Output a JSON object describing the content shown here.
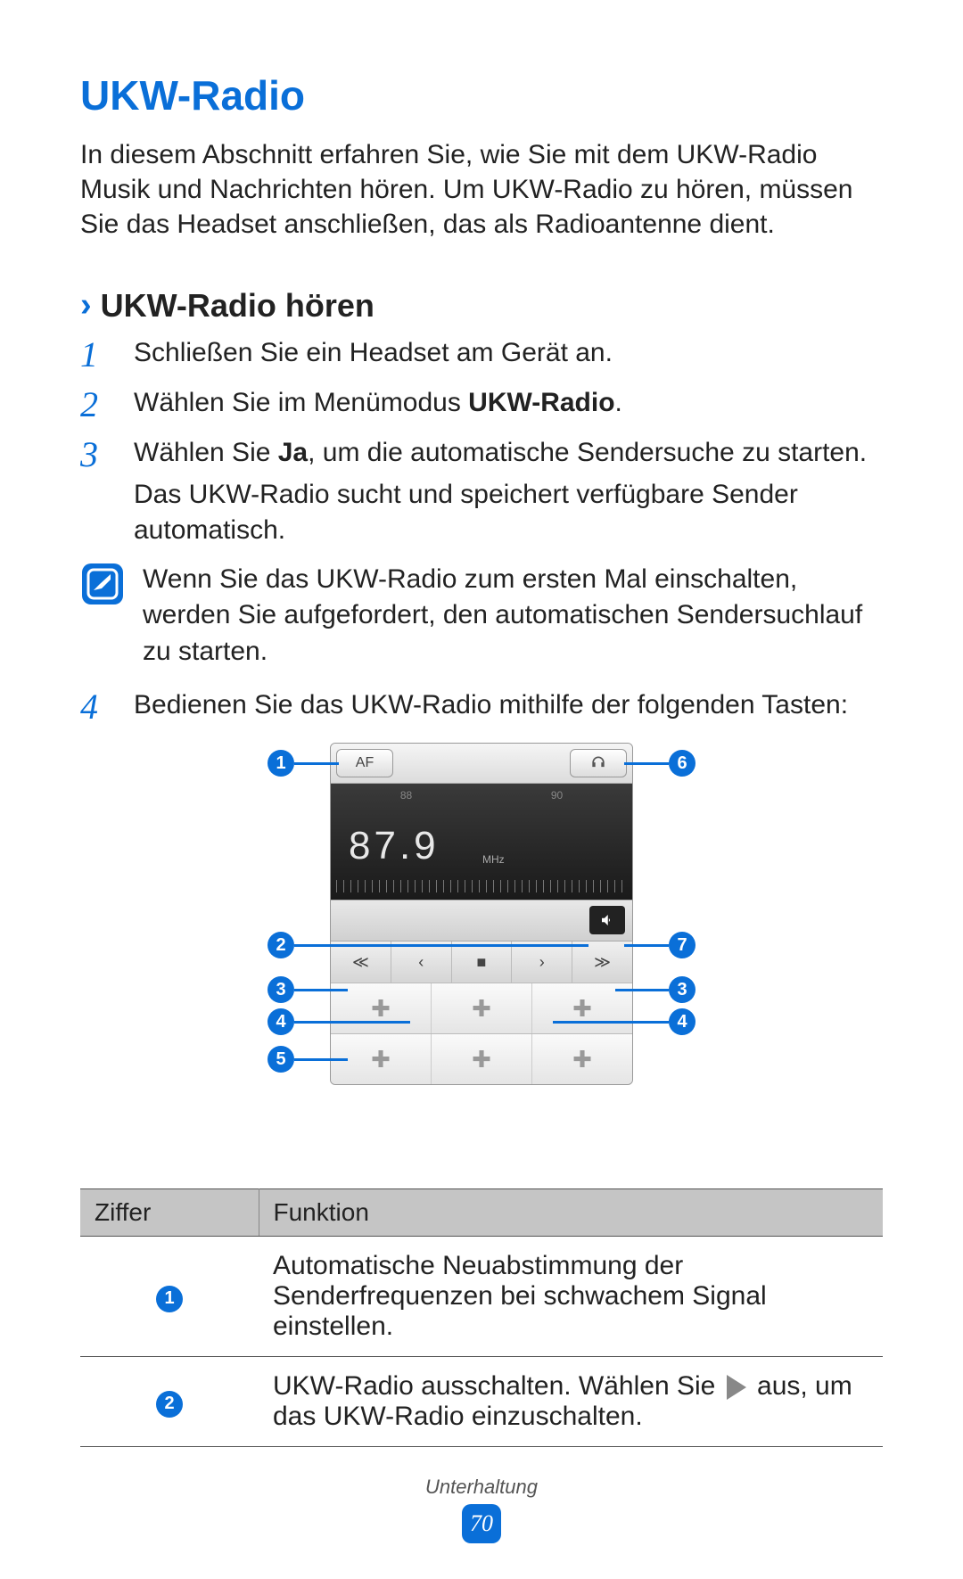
{
  "title": "UKW-Radio",
  "intro": "In diesem Abschnitt erfahren Sie, wie Sie mit dem UKW-Radio Musik und Nachrichten hören. Um UKW-Radio zu hören, müssen Sie das Headset anschließen, das als Radioantenne dient.",
  "section": {
    "chevron": "›",
    "heading": "UKW-Radio hören"
  },
  "steps": {
    "s1": {
      "num": "1",
      "text": "Schließen Sie ein Headset am Gerät an."
    },
    "s2": {
      "num": "2",
      "text_pre": "Wählen Sie im Menümodus ",
      "bold": "UKW-Radio",
      "text_post": "."
    },
    "s3": {
      "num": "3",
      "text_pre": "Wählen Sie ",
      "bold": "Ja",
      "text_post": ", um die automatische Sendersuche zu starten.",
      "sub": "Das UKW-Radio sucht und speichert verfügbare Sender automatisch."
    },
    "s4": {
      "num": "4",
      "text": "Bedienen Sie das UKW-Radio mithilfe der folgenden Tasten:"
    }
  },
  "note": "Wenn Sie das UKW-Radio zum ersten Mal einschalten, werden Sie aufgefordert, den automatischen Sendersuchlauf zu starten.",
  "radio": {
    "af": "AF",
    "dial_left": "88",
    "dial_right": "90",
    "freq": "87.9",
    "unit": "MHz",
    "ctrl_prev2": "≪",
    "ctrl_prev": "‹",
    "ctrl_stop": "■",
    "ctrl_next": "›",
    "ctrl_next2": "≫",
    "preset": "✚"
  },
  "callouts": {
    "c1": "1",
    "c2": "2",
    "c3": "3",
    "c4": "4",
    "c5": "5",
    "c6": "6",
    "c7": "7"
  },
  "table": {
    "head_ziffer": "Ziffer",
    "head_funktion": "Funktion",
    "row1": {
      "num": "1",
      "text": "Automatische Neuabstimmung der Senderfrequenzen bei schwachem Signal einstellen."
    },
    "row2": {
      "num": "2",
      "text_pre": "UKW-Radio ausschalten. Wählen Sie ",
      "text_post": " aus, um das UKW-Radio einzuschalten."
    }
  },
  "footer": {
    "category": "Unterhaltung",
    "page": "70"
  }
}
